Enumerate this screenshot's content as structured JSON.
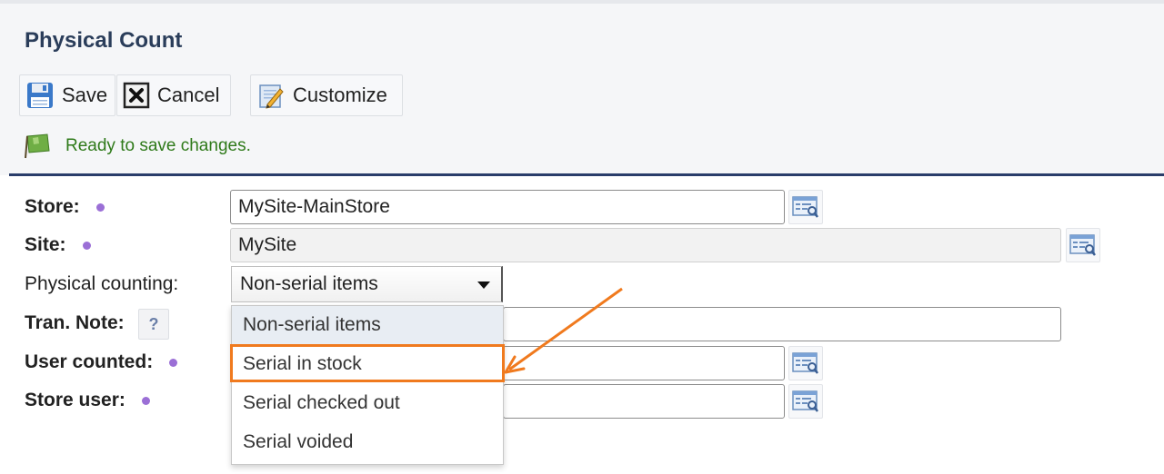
{
  "header": {
    "title": "Physical Count"
  },
  "toolbar": {
    "save_label": "Save",
    "cancel_label": "Cancel",
    "customize_label": "Customize"
  },
  "status": {
    "message": "Ready to save changes."
  },
  "form": {
    "store": {
      "label": "Store:",
      "value": "MySite-MainStore"
    },
    "site": {
      "label": "Site:",
      "value": "MySite"
    },
    "physical_counting": {
      "label": "Physical counting:",
      "value": "Non-serial items"
    },
    "tran_note": {
      "label": "Tran. Note:",
      "help": "?",
      "value": ""
    },
    "user_counted": {
      "label": "User counted:",
      "value": ""
    },
    "store_user": {
      "label": "Store user:",
      "value": ""
    }
  },
  "dropdown": {
    "options": [
      "Non-serial items",
      "Serial in stock",
      "Serial checked out",
      "Serial voided"
    ],
    "highlighted": "Serial in stock"
  },
  "colors": {
    "accent_title": "#2a3d5a",
    "status_green": "#2f7a1a",
    "required_dot": "#9b6fd6",
    "annotation_orange": "#f07a1e",
    "divider": "#2a3d6a"
  },
  "icons": {
    "save": "floppy-disk-icon",
    "cancel": "close-box-icon",
    "customize": "pencil-page-icon",
    "status": "green-flag-icon",
    "lookup": "lookup-list-icon"
  }
}
